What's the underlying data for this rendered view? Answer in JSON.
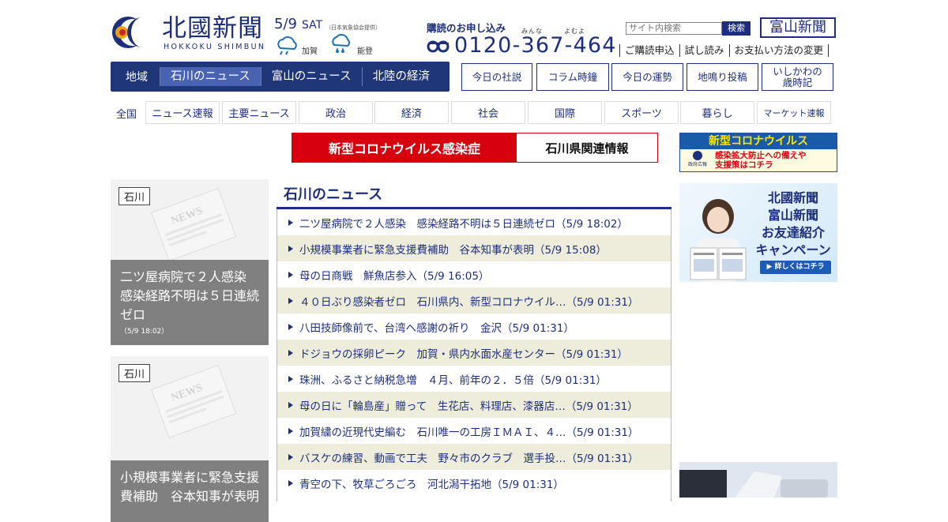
{
  "brand": {
    "name": "北國新聞",
    "romanized": "HOKKOKU SHIMBUN"
  },
  "weather": {
    "date": "5/9",
    "weekday": "SAT",
    "source": "（日本気象協会提供）",
    "locations": [
      {
        "name": "加賀",
        "icon": "rain-cloud-icon"
      },
      {
        "name": "能登",
        "icon": "heavy-rain-icon"
      }
    ]
  },
  "subscription": {
    "label": "購読のお申し込み",
    "ruby": "みんな　　　よむよ",
    "phone": "0120-367-464",
    "icon": "free-dial-icon"
  },
  "search": {
    "placeholder": "サイト内検索",
    "button": "検索"
  },
  "toyama_button": "富山新聞",
  "utility_links": [
    "ご購読申込",
    "試し読み",
    "お支払い方法の変更"
  ],
  "region_nav": {
    "label": "地域",
    "tabs": [
      "石川のニュース",
      "富山のニュース",
      "北陸の経済"
    ],
    "active": "石川のニュース"
  },
  "feature_buttons": [
    "今日の社説",
    "コラム時鐘",
    "今日の運勢",
    "地鳴り投稿",
    "いしかわの\n歳時記"
  ],
  "category_nav": {
    "label": "全国",
    "items": [
      "ニュース速報",
      "主要ニュース",
      "政治",
      "経済",
      "社会",
      "国際",
      "スポーツ",
      "暮らし",
      "マーケット速報"
    ]
  },
  "corona_banner": {
    "left": "新型コロナウイルス感染症",
    "right": "石川県関連情報"
  },
  "gov_banner": {
    "title": "新型コロナウイルス",
    "line1": "感染拡大防止への備えや",
    "line2": "支援策はコチラ",
    "logo_text": "政府広報"
  },
  "featured_cards": [
    {
      "tag": "石川",
      "title": "二ツ屋病院で２人感染　感染経路不明は５日連続ゼロ",
      "date": "（5/9 18:02）"
    },
    {
      "tag": "石川",
      "title": "小規模事業者に緊急支援費補助　谷本知事が表明",
      "date": ""
    }
  ],
  "news_section": {
    "title": "石川のニュース",
    "items": [
      "二ツ屋病院で２人感染　感染経路不明は５日連続ゼロ（5/9 18:02）",
      "小規模事業者に緊急支援費補助　谷本知事が表明（5/9 15:08）",
      "母の日商戦　鮮魚店参入（5/9 16:05）",
      "４０日ぶり感染者ゼロ　石川県内、新型コロナウイル…（5/9 01:31）",
      "八田技師像前で、台湾へ感謝の祈り　金沢（5/9 01:31）",
      "ドジョウの採卵ピーク　加賀・県内水面水産センター（5/9 01:31）",
      "珠洲、ふるさと納税急増　４月、前年の２．５倍（5/9 01:31）",
      "母の日に「輪島産」贈って　生花店、料理店、漆器店…（5/9 01:31）",
      "加賀繍の近現代史編む　石川唯一の工房ＩＭＡＩ、４…（5/9 01:31）",
      "バスケの練習、動画で工夫　野々市のクラブ　選手投…（5/9 01:31）",
      "青空の下、牧草ごろごろ　河北潟干拓地（5/9 01:31）"
    ]
  },
  "campaign_ad": {
    "line1": "北國新聞",
    "line2": "富山新聞",
    "line3": "お友達紹介",
    "line4": "キャンペーン",
    "cta": "▶ 詳しくはコチラ"
  },
  "colors": {
    "brand_navy": "#1d2f7c",
    "alert_red": "#d6000f",
    "row_alt": "#eeeddc"
  }
}
